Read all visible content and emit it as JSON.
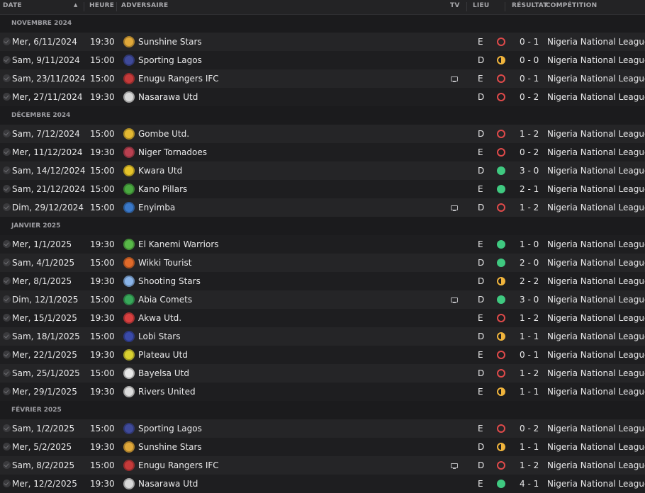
{
  "header": {
    "date": "DATE",
    "time": "HEURE",
    "opponent": "ADVERSAIRE",
    "tv": "TV",
    "venue": "LIEU",
    "result": "RÉSULTAT",
    "competition": "COMPÉTITION"
  },
  "colors": {
    "loss": "#e04a4a",
    "win": "#3fc980",
    "draw": "#f0b43c",
    "row_odd": "#252527",
    "row_even": "#1e1e20"
  },
  "groups": [
    {
      "month": "NOVEMBRE 2024",
      "matches": [
        {
          "date": "Mer, 6/11/2024",
          "time": "19:30",
          "opponent": "Sunshine Stars",
          "crest_icon": "sunshine-stars-crest",
          "crest_color": "#e0a83a",
          "tv": false,
          "venue": "E",
          "result": "loss",
          "score": "0 - 1",
          "competition": "Nigeria National League"
        },
        {
          "date": "Sam, 9/11/2024",
          "time": "15:00",
          "opponent": "Sporting Lagos",
          "crest_icon": "sporting-lagos-crest",
          "crest_color": "#3f4a9a",
          "tv": false,
          "venue": "D",
          "result": "draw",
          "score": "0 - 0",
          "competition": "Nigeria National League"
        },
        {
          "date": "Sam, 23/11/2024",
          "time": "15:00",
          "opponent": "Enugu Rangers IFC",
          "crest_icon": "enugu-rangers-crest",
          "crest_color": "#c43a3a",
          "tv": true,
          "venue": "E",
          "result": "loss",
          "score": "0 - 1",
          "competition": "Nigeria National League"
        },
        {
          "date": "Mer, 27/11/2024",
          "time": "19:30",
          "opponent": "Nasarawa Utd",
          "crest_icon": "nasarawa-utd-crest",
          "crest_color": "#d8d8d8",
          "tv": false,
          "venue": "D",
          "result": "loss",
          "score": "0 - 2",
          "competition": "Nigeria National League"
        }
      ]
    },
    {
      "month": "DÉCEMBRE 2024",
      "matches": [
        {
          "date": "Sam, 7/12/2024",
          "time": "15:00",
          "opponent": "Gombe Utd.",
          "crest_icon": "gombe-utd-crest",
          "crest_color": "#e3b832",
          "tv": false,
          "venue": "D",
          "result": "loss",
          "score": "1 - 2",
          "competition": "Nigeria National League"
        },
        {
          "date": "Mer, 11/12/2024",
          "time": "19:30",
          "opponent": "Niger Tornadoes",
          "crest_icon": "niger-tornadoes-crest",
          "crest_color": "#b84050",
          "tv": false,
          "venue": "E",
          "result": "loss",
          "score": "0 - 2",
          "competition": "Nigeria National League"
        },
        {
          "date": "Sam, 14/12/2024",
          "time": "15:00",
          "opponent": "Kwara Utd",
          "crest_icon": "kwara-utd-crest",
          "crest_color": "#e6c42a",
          "tv": false,
          "venue": "D",
          "result": "win",
          "score": "3 - 0",
          "competition": "Nigeria National League"
        },
        {
          "date": "Sam, 21/12/2024",
          "time": "15:00",
          "opponent": "Kano Pillars",
          "crest_icon": "kano-pillars-crest",
          "crest_color": "#4aa840",
          "tv": false,
          "venue": "E",
          "result": "win",
          "score": "2 - 1",
          "competition": "Nigeria National League"
        },
        {
          "date": "Dim, 29/12/2024",
          "time": "15:00",
          "opponent": "Enyimba",
          "crest_icon": "enyimba-crest",
          "crest_color": "#3a78c8",
          "tv": true,
          "venue": "D",
          "result": "loss",
          "score": "1 - 2",
          "competition": "Nigeria National League"
        }
      ]
    },
    {
      "month": "JANVIER 2025",
      "matches": [
        {
          "date": "Mer, 1/1/2025",
          "time": "19:30",
          "opponent": "El Kanemi Warriors",
          "crest_icon": "el-kanemi-warriors-crest",
          "crest_color": "#58b848",
          "tv": false,
          "venue": "E",
          "result": "win",
          "score": "1 - 0",
          "competition": "Nigeria National League"
        },
        {
          "date": "Sam, 4/1/2025",
          "time": "15:00",
          "opponent": "Wikki Tourist",
          "crest_icon": "wikki-tourist-crest",
          "crest_color": "#e06a2a",
          "tv": false,
          "venue": "D",
          "result": "win",
          "score": "2 - 0",
          "competition": "Nigeria National League"
        },
        {
          "date": "Mer, 8/1/2025",
          "time": "19:30",
          "opponent": "Shooting Stars",
          "crest_icon": "shooting-stars-crest",
          "crest_color": "#8ab4e8",
          "tv": false,
          "venue": "D",
          "result": "draw",
          "score": "2 - 2",
          "competition": "Nigeria National League"
        },
        {
          "date": "Dim, 12/1/2025",
          "time": "15:00",
          "opponent": "Abia Comets",
          "crest_icon": "abia-comets-crest",
          "crest_color": "#38a85a",
          "tv": true,
          "venue": "D",
          "result": "win",
          "score": "3 - 0",
          "competition": "Nigeria National League"
        },
        {
          "date": "Mer, 15/1/2025",
          "time": "19:30",
          "opponent": "Akwa Utd.",
          "crest_icon": "akwa-utd-crest",
          "crest_color": "#d84040",
          "tv": false,
          "venue": "E",
          "result": "loss",
          "score": "1 - 2",
          "competition": "Nigeria National League"
        },
        {
          "date": "Sam, 18/1/2025",
          "time": "15:00",
          "opponent": "Lobi Stars",
          "crest_icon": "lobi-stars-crest",
          "crest_color": "#3a4aa8",
          "tv": false,
          "venue": "D",
          "result": "draw",
          "score": "1 - 1",
          "competition": "Nigeria National League"
        },
        {
          "date": "Mer, 22/1/2025",
          "time": "19:30",
          "opponent": "Plateau Utd",
          "crest_icon": "plateau-utd-crest",
          "crest_color": "#d8d030",
          "tv": false,
          "venue": "E",
          "result": "loss",
          "score": "0 - 1",
          "competition": "Nigeria National League"
        },
        {
          "date": "Sam, 25/1/2025",
          "time": "15:00",
          "opponent": "Bayelsa Utd",
          "crest_icon": "bayelsa-utd-crest",
          "crest_color": "#e8e8e8",
          "tv": false,
          "venue": "D",
          "result": "loss",
          "score": "1 - 2",
          "competition": "Nigeria National League"
        },
        {
          "date": "Mer, 29/1/2025",
          "time": "19:30",
          "opponent": "Rivers United",
          "crest_icon": "rivers-united-crest",
          "crest_color": "#dcdcdc",
          "tv": false,
          "venue": "E",
          "result": "draw",
          "score": "1 - 1",
          "competition": "Nigeria National League"
        }
      ]
    },
    {
      "month": "FÉVRIER 2025",
      "matches": [
        {
          "date": "Sam, 1/2/2025",
          "time": "15:00",
          "opponent": "Sporting Lagos",
          "crest_icon": "sporting-lagos-crest",
          "crest_color": "#3f4a9a",
          "tv": false,
          "venue": "E",
          "result": "loss",
          "score": "0 - 2",
          "competition": "Nigeria National League"
        },
        {
          "date": "Mer, 5/2/2025",
          "time": "19:30",
          "opponent": "Sunshine Stars",
          "crest_icon": "sunshine-stars-crest",
          "crest_color": "#e0a83a",
          "tv": false,
          "venue": "D",
          "result": "draw",
          "score": "1 - 1",
          "competition": "Nigeria National League"
        },
        {
          "date": "Sam, 8/2/2025",
          "time": "15:00",
          "opponent": "Enugu Rangers IFC",
          "crest_icon": "enugu-rangers-crest",
          "crest_color": "#c43a3a",
          "tv": true,
          "venue": "D",
          "result": "loss",
          "score": "1 - 2",
          "competition": "Nigeria National League"
        },
        {
          "date": "Mer, 12/2/2025",
          "time": "19:30",
          "opponent": "Nasarawa Utd",
          "crest_icon": "nasarawa-utd-crest",
          "crest_color": "#d8d8d8",
          "tv": false,
          "venue": "E",
          "result": "win",
          "score": "4 - 1",
          "competition": "Nigeria National League"
        }
      ]
    }
  ]
}
